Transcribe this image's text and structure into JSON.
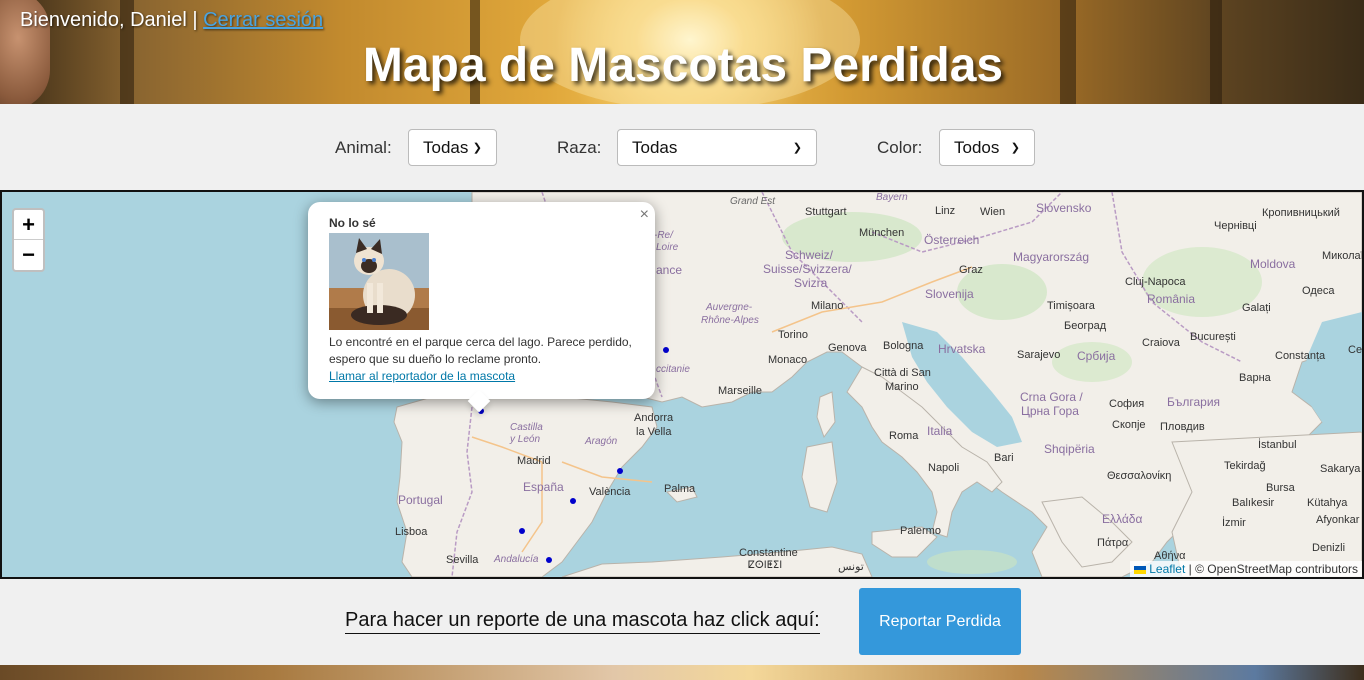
{
  "header": {
    "welcome_text": "Bienvenido, Daniel",
    "separator": "|",
    "logout_label": "Cerrar sesión",
    "title": "Mapa de Mascotas Perdidas"
  },
  "filters": {
    "animal": {
      "label": "Animal:",
      "selected": "Todas"
    },
    "breed": {
      "label": "Raza:",
      "selected": "Todas"
    },
    "color": {
      "label": "Color:",
      "selected": "Todos"
    }
  },
  "map": {
    "zoom_in": "+",
    "zoom_out": "−",
    "attribution_link": "Leaflet",
    "attribution_text": "| © OpenStreetMap contributors",
    "labels": {
      "grand_est": "Grand Est",
      "stuttgart": "Stuttgart",
      "bayern": "Bayern",
      "linz": "Linz",
      "wien": "Wien",
      "slovensko": "Slovensko",
      "kropyvnytskyi": "Кропивницький",
      "chernivtsi": "Чернівці",
      "muenchen": "München",
      "oesterreich": "Österreich",
      "schweiz1": "Schweiz/",
      "schweiz2": "Suisse/Svizzera/",
      "schweiz3": "Svizra",
      "graz": "Graz",
      "magyarorszag": "Magyarország",
      "cluj": "Cluj-Napoca",
      "moldova": "Moldova",
      "mykolai": "Миколаї",
      "re_loire": "-Re/",
      "loire": "Loire",
      "france": "ance",
      "auvergne1": "Auvergne-",
      "auvergne2": "Rhône-Alpes",
      "milano": "Milano",
      "slovenija": "Slovenija",
      "timisoara": "Timișoara",
      "romania": "România",
      "galati": "Galați",
      "odesa": "Одеса",
      "torino": "Torino",
      "beograd": "Београд",
      "craiova": "Craiova",
      "bucuresti": "București",
      "monaco": "Monaco",
      "genova": "Genova",
      "bologna": "Bologna",
      "hrvatska": "Hrvatska",
      "sarajevo": "Sarajevo",
      "srbija": "Србија",
      "constanta": "Constanța",
      "ce": "Ce",
      "occitanie": "ccitanie",
      "citta1": "Città di San",
      "citta2": "Marino",
      "varna": "Варна",
      "marseille": "Marseille",
      "crna1": "Crna Gora /",
      "crna2": "Црна Гора",
      "sofia": "София",
      "bulgaria": "България",
      "andorra1": "Andorra",
      "andorra2": "la Vella",
      "castilla1": "Castilla",
      "castilla2": "y León",
      "aragon": "Aragón",
      "italia": "Italia",
      "roma": "Roma",
      "bari": "Bari",
      "skopje": "Скопје",
      "plovdiv": "Пловдив",
      "istanbul": "İstanbul",
      "shqiperia": "Shqipëria",
      "madrid": "Madrid",
      "espana": "España",
      "valencia": "València",
      "palma": "Palma",
      "napoli": "Napoli",
      "tekirdag": "Tekirdağ",
      "sakarya": "Sakarya",
      "thessaloniki": "Θεσσαλονίκη",
      "portugal": "Portugal",
      "bursa": "Bursa",
      "balikesir": "Balıkesir",
      "kutahya": "Kütahya",
      "ellada": "Ελλάδα",
      "lisboa": "Lisboa",
      "palermo": "Palermo",
      "izmir": "İzmir",
      "afyonkar": "Afyonkar",
      "patra": "Πάτρα",
      "athina": "Αθήνα",
      "denizli": "Denizli",
      "sevilla": "Sevilla",
      "andalucia": "Andalucía",
      "constantine": "Constantine",
      "berber": "ⵇⵙⵏⵟⵉⵏ",
      "tunis": "تونس"
    },
    "popup": {
      "close": "×",
      "title": "No lo sé",
      "description": "Lo encontré en el parque cerca del lago. Parece perdido, espero que su dueño lo reclame pronto.",
      "link": "Llamar al reportador de la mascota"
    },
    "marker_color": "#0000cc"
  },
  "footer": {
    "cta_text": "Para hacer un reporte de una mascota haz click aquí:",
    "report_button": "Reportar Perdida"
  },
  "colors": {
    "accent": "#3498db",
    "link": "#0078a8",
    "sea": "#aad3df",
    "land": "#f2efe9"
  }
}
